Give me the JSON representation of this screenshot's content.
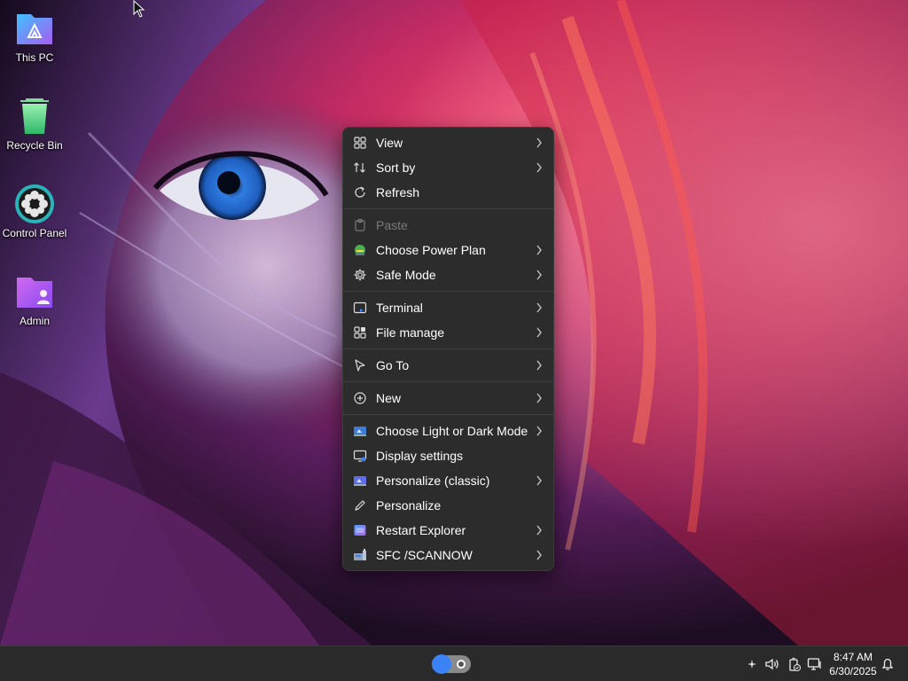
{
  "desktop": {
    "icons": [
      {
        "label": "This PC",
        "icon": "this-pc-folder-icon"
      },
      {
        "label": "Recycle Bin",
        "icon": "recycle-bin-icon"
      },
      {
        "label": "Control Panel",
        "icon": "control-panel-gear-icon"
      },
      {
        "label": "Admin",
        "icon": "user-folder-icon"
      }
    ]
  },
  "context_menu": {
    "items": [
      {
        "label": "View",
        "icon": "grid-view-icon",
        "submenu": true
      },
      {
        "label": "Sort by",
        "icon": "sort-icon",
        "submenu": true
      },
      {
        "label": "Refresh",
        "icon": "refresh-icon",
        "submenu": false
      },
      {
        "label": "Paste",
        "icon": "paste-icon",
        "submenu": false,
        "disabled": true
      },
      {
        "label": "Choose Power Plan",
        "icon": "power-plan-icon",
        "submenu": true
      },
      {
        "label": "Safe Mode",
        "icon": "gear-icon",
        "submenu": true
      },
      {
        "label": "Terminal",
        "icon": "terminal-icon",
        "submenu": true
      },
      {
        "label": "File manage",
        "icon": "file-manage-icon",
        "submenu": true
      },
      {
        "label": "Go To",
        "icon": "cursor-arrow-icon",
        "submenu": true
      },
      {
        "label": "New",
        "icon": "plus-circle-icon",
        "submenu": true
      },
      {
        "label": "Choose Light or Dark Mode",
        "icon": "theme-mode-icon",
        "submenu": true
      },
      {
        "label": "Display settings",
        "icon": "display-settings-icon",
        "submenu": false
      },
      {
        "label": "Personalize (classic)",
        "icon": "personalize-classic-icon",
        "submenu": true
      },
      {
        "label": "Personalize",
        "icon": "pen-icon",
        "submenu": false
      },
      {
        "label": "Restart Explorer",
        "icon": "restart-explorer-icon",
        "submenu": true
      },
      {
        "label": "SFC /SCANNOW",
        "icon": "sfc-scan-icon",
        "submenu": true
      }
    ]
  },
  "taskbar": {
    "center_toggle_icon": "toggle-switch-icon",
    "tray_icons": [
      "sparkle-icon",
      "volume-icon",
      "battery-icon",
      "network-icon",
      "notification-bell-icon"
    ],
    "time": "8:47 AM",
    "date": "6/30/2025"
  },
  "colors": {
    "menu_bg": "#2c2c2c",
    "accent": "#3b82f6",
    "taskbar_bg": "#2a2a2b"
  }
}
